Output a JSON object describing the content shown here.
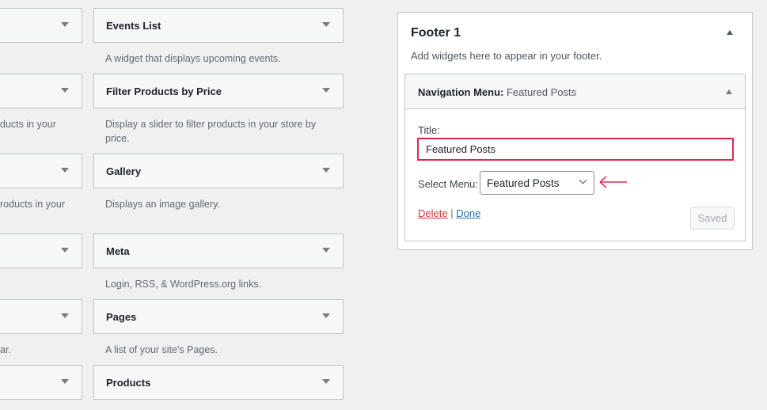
{
  "left_column": [
    {
      "title": "",
      "desc": ""
    },
    {
      "title": "",
      "desc": "ducts in your"
    },
    {
      "title": "",
      "desc": "roducts in your"
    },
    {
      "title": "",
      "desc": ""
    },
    {
      "title": "",
      "desc": "ar."
    },
    {
      "title": "",
      "desc": ""
    }
  ],
  "right_column": [
    {
      "title": "Events List",
      "desc": "A widget that displays upcoming events."
    },
    {
      "title": "Filter Products by Price",
      "desc": "Display a slider to filter products in your store by price."
    },
    {
      "title": "Gallery",
      "desc": "Displays an image gallery."
    },
    {
      "title": "Meta",
      "desc": "Login, RSS, & WordPress.org links."
    },
    {
      "title": "Pages",
      "desc": "A list of your site's Pages."
    },
    {
      "title": "Products",
      "desc": ""
    }
  ],
  "sidebar": {
    "title": "Footer 1",
    "description": "Add widgets here to appear in your footer.",
    "widget": {
      "type": "Navigation Menu:",
      "name": "Featured Posts",
      "title_label": "Title:",
      "title_value": "Featured Posts",
      "select_label": "Select Menu:",
      "select_value": "Featured Posts",
      "delete": "Delete",
      "separator": "|",
      "done": "Done",
      "saved": "Saved"
    }
  },
  "colors": {
    "highlight": "#e0284f",
    "link": "#2271b1",
    "delete": "#d63638"
  }
}
